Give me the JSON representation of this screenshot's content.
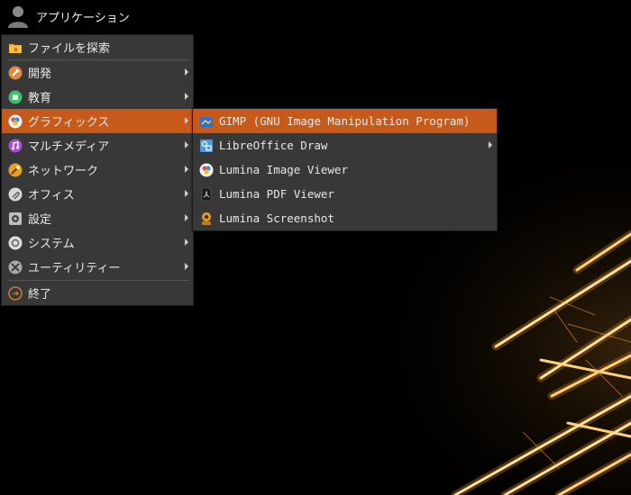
{
  "topbar": {
    "label": "アプリケーション",
    "icon": "user-icon"
  },
  "main_menu": {
    "items": [
      {
        "label": "ファイルを探索",
        "icon": "folder-icon",
        "submenu": false
      },
      {
        "label": "開発",
        "icon": "hammer-icon",
        "submenu": true
      },
      {
        "label": "教育",
        "icon": "education-icon",
        "submenu": true
      },
      {
        "label": "グラフィックス",
        "icon": "graphics-icon",
        "submenu": true,
        "active": true
      },
      {
        "label": "マルチメディア",
        "icon": "music-icon",
        "submenu": true
      },
      {
        "label": "ネットワーク",
        "icon": "network-icon",
        "submenu": true
      },
      {
        "label": "オフィス",
        "icon": "paperclip-icon",
        "submenu": true
      },
      {
        "label": "設定",
        "icon": "settings-icon",
        "submenu": true
      },
      {
        "label": "システム",
        "icon": "system-icon",
        "submenu": true
      },
      {
        "label": "ユーティリティー",
        "icon": "tools-icon",
        "submenu": true
      },
      {
        "label": "終了",
        "icon": "exit-icon",
        "submenu": false
      }
    ]
  },
  "graphics_submenu": {
    "items": [
      {
        "label": "GIMP (GNU Image Manipulation Program)",
        "icon": "gimp-icon",
        "submenu": false,
        "active": true
      },
      {
        "label": "LibreOffice Draw",
        "icon": "draw-icon",
        "submenu": true
      },
      {
        "label": "Lumina Image Viewer",
        "icon": "image-viewer-icon",
        "submenu": false
      },
      {
        "label": "Lumina PDF Viewer",
        "icon": "pdf-icon",
        "submenu": false
      },
      {
        "label": "Lumina Screenshot",
        "icon": "screenshot-icon",
        "submenu": false
      }
    ]
  },
  "colors": {
    "active": "#c55a1b",
    "menu_bg": "#383838",
    "wallpaper_glow": "#ffb040"
  }
}
